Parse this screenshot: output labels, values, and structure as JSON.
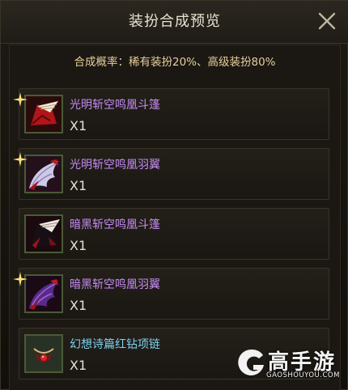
{
  "dialog": {
    "title": "装扮合成预览",
    "rate_text": "合成概率：稀有装扮20%、高级装扮80%"
  },
  "items": [
    {
      "name": "光明斩空鸣凰斗篷",
      "qty": "X1",
      "name_color": "#c58cf2",
      "icon": "bright-cloak-icon"
    },
    {
      "name": "光明斩空鸣凰羽翼",
      "qty": "X1",
      "name_color": "#c58cf2",
      "icon": "bright-wing-icon"
    },
    {
      "name": "暗黑斩空鸣凰斗篷",
      "qty": "X1",
      "name_color": "#c58cf2",
      "icon": "dark-cloak-icon"
    },
    {
      "name": "暗黑斩空鸣凰羽翼",
      "qty": "X1",
      "name_color": "#c58cf2",
      "icon": "dark-wing-icon"
    },
    {
      "name": "幻想诗篇红钻项链",
      "qty": "X1",
      "name_color": "#7fd0f0",
      "icon": "ruby-necklace-icon"
    }
  ],
  "watermark": {
    "brand": "高手游",
    "url": "GAOSHOUYOU.COM"
  }
}
